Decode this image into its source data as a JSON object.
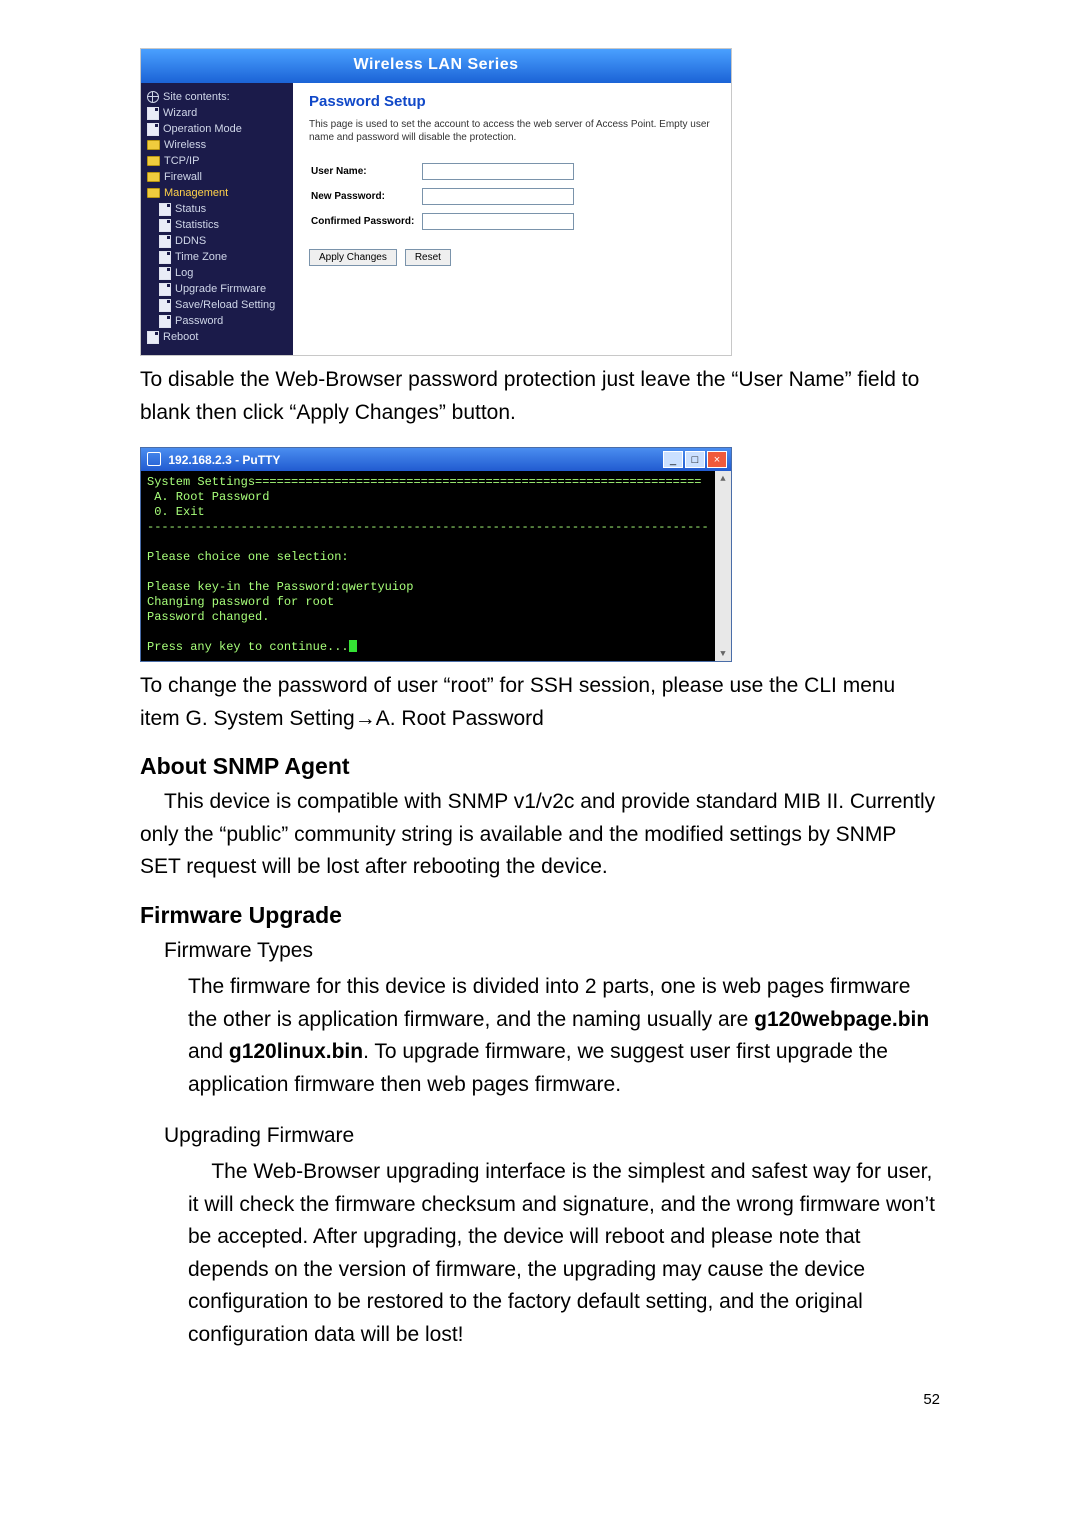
{
  "router": {
    "header_title": "Wireless LAN Series",
    "site_contents": "Site contents:",
    "sidebar": [
      {
        "label": "Wizard"
      },
      {
        "label": "Operation Mode"
      },
      {
        "label": "Wireless"
      },
      {
        "label": "TCP/IP"
      },
      {
        "label": "Firewall"
      },
      {
        "label": "Management",
        "hl": true
      },
      {
        "label": "Status",
        "sub": true
      },
      {
        "label": "Statistics",
        "sub": true
      },
      {
        "label": "DDNS",
        "sub": true
      },
      {
        "label": "Time Zone",
        "sub": true
      },
      {
        "label": "Log",
        "sub": true
      },
      {
        "label": "Upgrade Firmware",
        "sub": true
      },
      {
        "label": "Save/Reload Setting",
        "sub": true
      },
      {
        "label": "Password",
        "sub": true
      },
      {
        "label": "Reboot"
      }
    ],
    "main_title": "Password Setup",
    "main_desc": "This page is used to set the account to access the web server of Access Point. Empty user name and password will disable the protection.",
    "fields": {
      "user_name_label": "User Name:",
      "new_password_label": "New Password:",
      "confirm_password_label": "Confirmed Password:"
    },
    "apply_label": "Apply Changes",
    "reset_label": "Reset"
  },
  "body_text": {
    "para1": "To disable the Web-Browser password protection just leave the “User Name” field to blank then click “Apply Changes” button.",
    "para2": "To change the password of user “root” for SSH session, please use the CLI menu item G. System Setting→A. Root Password",
    "about_snmp_h": "About SNMP Agent",
    "about_snmp_p": "This device is compatible with SNMP v1/v2c and provide standard MIB II. Currently only the “public” community string is available and the modified settings by SNMP SET request will be lost after rebooting the device.",
    "fw_upgrade_h": "Firmware Upgrade",
    "fw_types_h": "Firmware Types",
    "fw_types_p_pre": "The firmware for this device is divided into 2 parts, one is web pages firmware the other is application firmware, and the naming usually are ",
    "fw_bin1": "g120webpage.bin",
    "fw_and": " and ",
    "fw_bin2": "g120linux.bin",
    "fw_types_p_post": ". To upgrade firmware, we suggest user first upgrade the application firmware then web pages firmware.",
    "upgrading_fw_h": "Upgrading Firmware",
    "upgrading_fw_p": "    The Web-Browser upgrading interface is the simplest and safest way for user, it will check the firmware checksum and signature, and the wrong firmware won’t be accepted. After upgrading, the device will reboot and please note that depends on the version of firmware, the upgrading may cause the device configuration to be restored to the factory default setting, and the original configuration data will be lost!"
  },
  "putty": {
    "title": "192.168.2.3 - PuTTY",
    "screen": "System Settings==============================================================\n A. Root Password\n 0. Exit\n------------------------------------------------------------------------------\n\nPlease choice one selection:\n\nPlease key-in the Password:qwertyuiop\nChanging password for root\nPassword changed.\n\nPress any key to continue..."
  },
  "page_number": "52"
}
